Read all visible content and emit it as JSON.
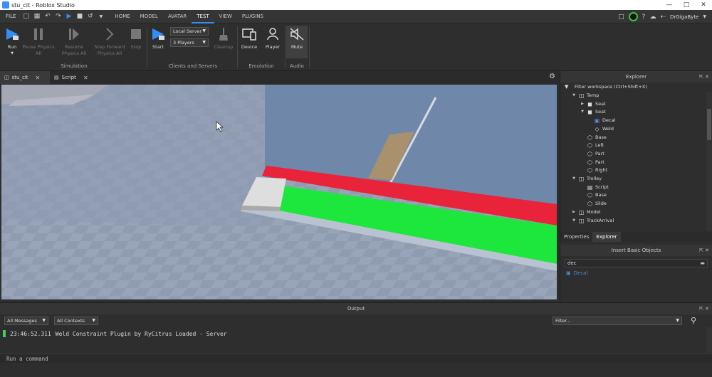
{
  "window": {
    "title": "stu_cit - Roblox Studio"
  },
  "menubar": {
    "file": "FILE",
    "tabs": [
      "HOME",
      "MODEL",
      "AVATAR",
      "TEST",
      "VIEW",
      "PLUGINS"
    ],
    "active_tab": "TEST",
    "username": "DrGigaByte"
  },
  "ribbon": {
    "simulation": {
      "label": "Simulation",
      "run": "Run",
      "pause_l1": "Pause Physics",
      "pause_l2": "All",
      "resume_l1": "Resume",
      "resume_l2": "Physics All",
      "step_l1": "Step Forward",
      "step_l2": "Physics All",
      "stop": "Stop"
    },
    "clients": {
      "label": "Clients and Servers",
      "start": "Start",
      "server_mode": "Local Server",
      "players": "3 Players",
      "cleanup": "Cleanup"
    },
    "emulation": {
      "label": "Emulation",
      "device": "Device",
      "player": "Player"
    },
    "audio": {
      "label": "Audio",
      "mute": "Mute"
    }
  },
  "doctabs": [
    {
      "label": "stu_cit"
    },
    {
      "label": "Script"
    }
  ],
  "explorer": {
    "title": "Explorer",
    "filter_placeholder": "Filter workspace (Ctrl+Shift+X)",
    "items": [
      {
        "label": "Temp",
        "icon": "model-icon"
      },
      {
        "label": "Seat",
        "icon": "seat-icon"
      },
      {
        "label": "Seat",
        "icon": "seat-icon"
      },
      {
        "label": "Decal",
        "icon": "decal-icon"
      },
      {
        "label": "Weld",
        "icon": "weld-icon"
      },
      {
        "label": "Base",
        "icon": "part-icon"
      },
      {
        "label": "Left",
        "icon": "part-icon"
      },
      {
        "label": "Part",
        "icon": "part-icon"
      },
      {
        "label": "Part",
        "icon": "part-icon"
      },
      {
        "label": "Right",
        "icon": "part-icon"
      },
      {
        "label": "Trolley",
        "icon": "model-icon"
      },
      {
        "label": "Script",
        "icon": "script-icon"
      },
      {
        "label": "Base",
        "icon": "part-icon"
      },
      {
        "label": "Slide",
        "icon": "part-icon"
      },
      {
        "label": "Model",
        "icon": "model-icon"
      },
      {
        "label": "TrackArrival",
        "icon": "model-icon"
      }
    ],
    "tabs": [
      "Properties",
      "Explorer"
    ]
  },
  "insert_objects": {
    "title": "Insert Basic Objects",
    "search_value": "dec",
    "result": "Decal"
  },
  "output": {
    "title": "Output",
    "filter_messages": "All Messages",
    "filter_contexts": "All Contexts",
    "filter_placeholder": "Filter...",
    "lines": [
      {
        "time": "23:46:52.311",
        "text": "Weld Constraint Plugin by RyCitrus Loaded  -  Server"
      }
    ]
  },
  "command": {
    "placeholder": "Run a command"
  }
}
